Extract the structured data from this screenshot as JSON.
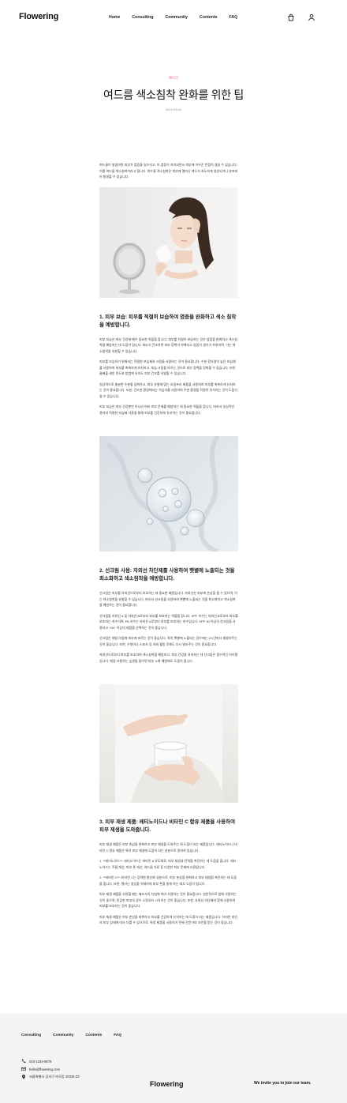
{
  "header": {
    "logo": "Flowering",
    "nav": [
      "Home",
      "Consulting",
      "Community",
      "Contents",
      "FAQ"
    ],
    "icons": [
      "bag-icon",
      "user-icon"
    ]
  },
  "post": {
    "category": "메이크",
    "title": "여드름 색소침착 완화를 위한 팁",
    "date": "2022.03.04",
    "intro": "여드름이 발생하면 피부가 염증을 일으키고, 이 염증이 지속되면서 피부에 어두운 반점이 생길 수 있습니다. 이를 여드름 색소침착이라고 합니다. 여드름 색소침착은 피부에 멜라닌 색소가 과도하게 생성되거나 분포되어 발생할 수 있습니다.",
    "sections": [
      {
        "heading": "1. 피부 보습: 피부를 적절히 보습하여 염증을 완화하고 색소 침착을 예방합니다.",
        "paragraphs": [
          "피부 보습은 피부 건강에 매우 중요한 역할을 합니다. 피부를 적절히 보습하는 것은 염증을 완화하고 색소침착을 예방하는 데 도움이 됩니다. 피부가 건조하면 피부 장벽이 약해지고 염증이 생기기 쉬워지며, 이는 색소침착을 유발할 수 있습니다.",
          "피부를 보습하기 위해서는 적절한 보습제와 크림을 사용하는 것이 중요합니다. 수분 함유량이 높은 보습제를 사용하여 피부를 촉촉하게 유지하고, 보습 크림을 바르는 것으로 피부 장벽을 강화할 수 있습니다. 또한, 물배출 세안 빈도와 방법에 유의도 피부 건조를 유발할 수 있습니다.",
          "일상적으로 충분한 수분을 섭취하고, 피부 유형에 맞는 오일프리 제품을 사용하여 피부를 촉촉하게 유지하는 것이 중요합니다. 또한, 건조한 환경에서는 가습기를 사용하여 주변 환경을 적절히 유지하는 것이 도움이 될 수 있습니다.",
          "피부 보습은 피부 건강뿐만 아니라 여러 피부 문제를 예방하는 데 중요한 역할을 합니다. 따라서 일상적인 관리와 적절한 보습제 사용을 통해 피부를 건강하게 유지하는 것이 중요합니다."
        ]
      },
      {
        "heading": "2. 선크림 사용: 자외선 차단제를 사용하여 햇볕에 노출되는 것을 최소화하고 색소침착을 예방합니다.",
        "paragraphs": [
          "선크림은 피부를 자외선으로부터 보호하는 데 중요한 제품입니다. 자외선은 피부에 손상을 줄 수 있으며, 이는 색소침착을 유발할 수 있습니다. 따라서 선크림을 사용하여 햇볕에 노출되는 것을 최소화하고 색소침착을 예방하는 것이 중요합니다.",
          "선크림을 자외선 A 및 자외선 B로부터 피부를 보호하는 역할을 합니다. SPF 지수는 자외선 B로부터 피부를 보호하는 지수이며, PA 지수는 자외선 A로부터 피부를 보호하는 지수입니다. SPF 30 이상의 선크림을 사용하고, PA+ 이상의 제품을 선택하는 것이 좋습니다.",
          "선크림은 매일 아침에 피부에 바르는 것이 좋습니다. 특히 햇볕에 노출되는 경우에는 2시간마다 재발라주는 것이 좋습니다. 또한, 수영이나 스포츠 등 야외 활동 후에도 다시 발라주는 것이 중요합니다.",
          "자외선으로부터 피부를 보호하여 색소침착을 예방하고, 피부 건강을 유지하는 데 선크림은 필수적인 아이템입니다. 매일 사용하는 습관을 들이면 피부 노화 예방에도 도움이 됩니다."
        ]
      },
      {
        "heading": "3. 피부 재생 제품: 레티노이드나 비타민 C 함유 제품을 사용하여 피부 재생을 도와줍니다.",
        "paragraphs": [
          "피부 재생 제품은 피부 손상을 완화하고 피부 재생을 도와주는 데 도움이 되는 제품입니다. 레티노이드나 비타민 C 함유 제품은 특히 피부 재생에 도움이 되는 성분으로 알려져 있습니다.",
          "1. **레티노이드**: 레티노이드는 비타민 A 유도체로, 피부 재생과 탄력을 촉진하는 데 도움을 줍니다. 레티노이드는 주름 개선, 피부 톤 개선, 여드름 치료 등 다양한 피부 문제에 사용됩니다.",
          "2. **비타민 C**: 비타민 C는 강력한 항산화 성분으로, 피부 손상을 완화하고 피부 재생을 촉진하는 데 도움을 줍니다. 또한, 멜라닌 생성을 억제하여 피부 톤을 밝게 하는 데도 도움이 됩니다.",
          "피부 재생 제품을 사용할 때는 제조사의 지침에 따라 사용하는 것이 중요합니다. 일반적으로 밤에 사용하는 것이 좋으며, 민감한 피부의 경우 소량부터 시작하는 것이 좋습니다. 또한, 자외선 차단제와 함께 사용하여 피부를 보호하는 것이 좋습니다.",
          "피부 재생 제품은 피부 손상을 회복하고 피부를 건강하게 유지하는 데 도움이 되는 제품입니다. 하지만 개인의 피부 상태에 따라 다를 수 있으므로, 특정 제품을 사용하기 전에 전문가의 조언을 받는 것이 좋습니다."
        ]
      }
    ]
  },
  "footer": {
    "nav": [
      "Consulting",
      "Community",
      "Contents",
      "FAQ"
    ],
    "phone": "010-1234-5678",
    "email": "hello@flowering.com",
    "address": "서울특별시 강서구 마곡동 33333-33",
    "logo": "Flowering",
    "tagline": "We invite you to join our team."
  },
  "colors": {
    "accent": "#e46c8a",
    "footer_bg": "#f4f4f4"
  }
}
